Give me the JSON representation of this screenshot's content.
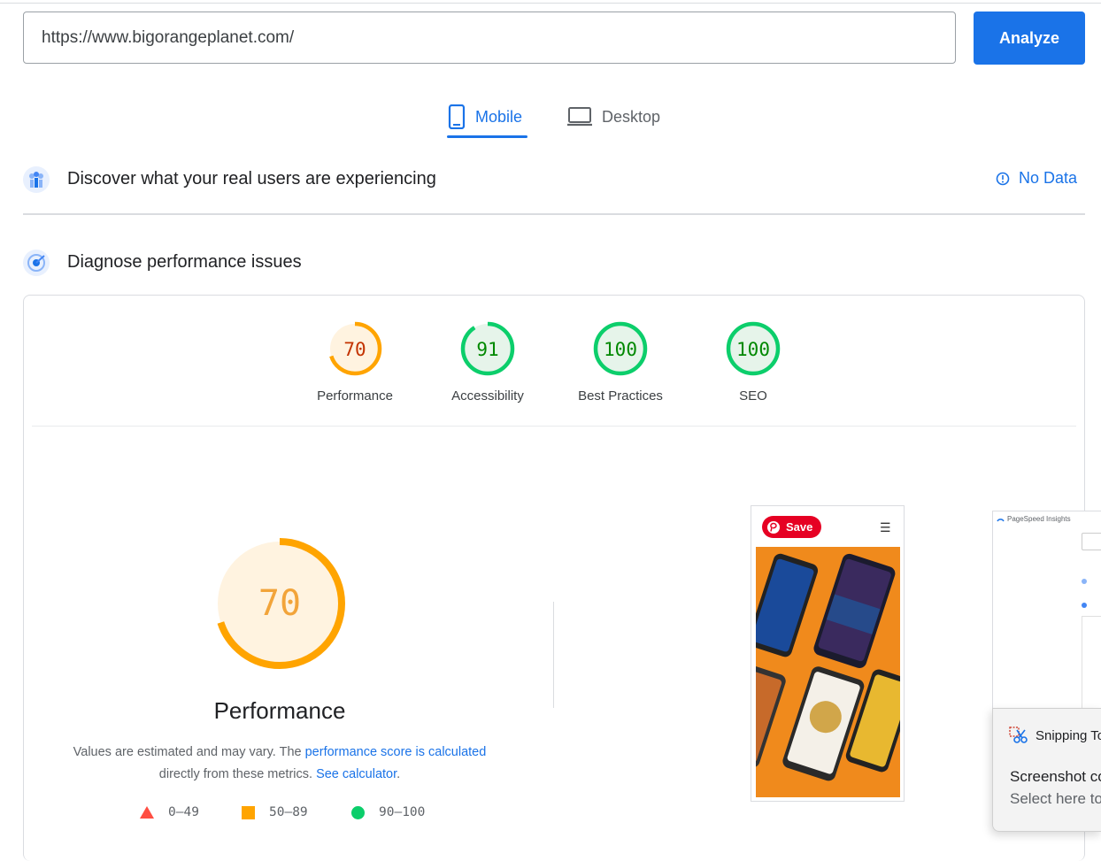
{
  "search": {
    "url": "https://www.bigorangeplanet.com/"
  },
  "toolbar": {
    "analyze_label": "Analyze"
  },
  "tabs": [
    {
      "label": "Mobile",
      "selected": true
    },
    {
      "label": "Desktop",
      "selected": false
    }
  ],
  "field_data": {
    "title": "Discover what your real users are experiencing",
    "status": "No Data"
  },
  "lab_data": {
    "title": "Diagnose performance issues"
  },
  "scores": [
    {
      "value": "70",
      "label": "Performance",
      "color": "#ffa400"
    },
    {
      "value": "91",
      "label": "Accessibility",
      "color": "#0cce6b"
    },
    {
      "value": "100",
      "label": "Best Practices",
      "color": "#0cce6b"
    },
    {
      "value": "100",
      "label": "SEO",
      "color": "#0cce6b"
    }
  ],
  "main_score": {
    "value": "70",
    "fraction": 0.7,
    "title": "Performance",
    "desc_start": "Values are estimated and may vary. The ",
    "desc_link1": "performance score is calculated",
    "desc_mid": "directly from these metrics. ",
    "desc_link2": "See calculator",
    "desc_end": "."
  },
  "legend": [
    {
      "range": "0–49",
      "shape": "triangle",
      "color": "#ff4e42"
    },
    {
      "range": "50–89",
      "shape": "square",
      "color": "#ffa400"
    },
    {
      "range": "90–100",
      "shape": "circle",
      "color": "#0cce6b"
    }
  ],
  "screenshot": {
    "save_label": "Save"
  },
  "popup": {
    "app_name": "PageSpeed Insights"
  },
  "toast": {
    "app": "Snipping To",
    "title": "Screenshot co",
    "subtitle": "Select here to"
  },
  "colors": {
    "accent": "#1a73e8",
    "average": "#ffa400",
    "pass": "#0cce6b",
    "fail": "#ff4e42"
  }
}
